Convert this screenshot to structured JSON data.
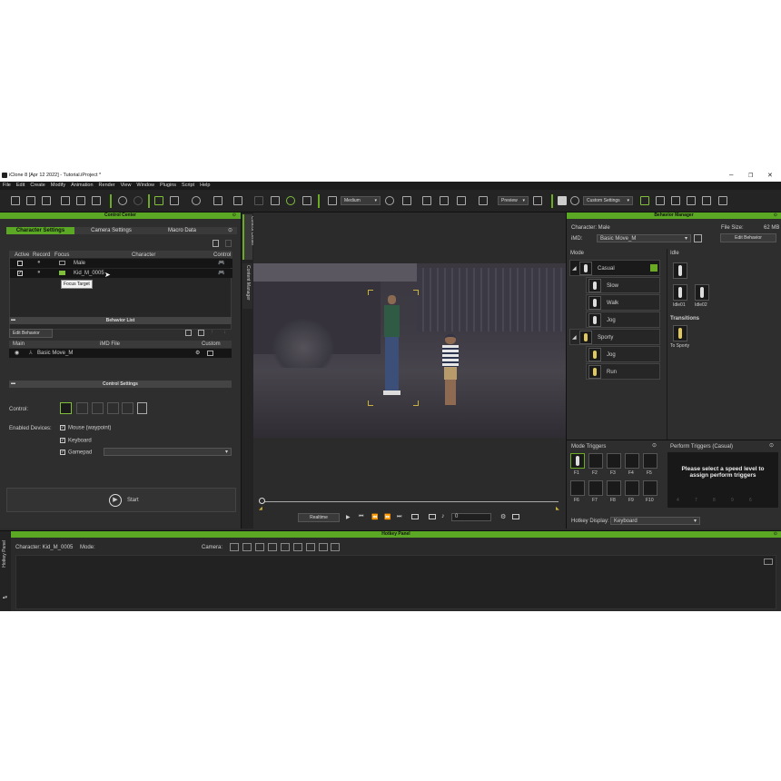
{
  "app": {
    "title": "iClone 8 [Apr 12 2022] - Tutorial.iProject *"
  },
  "menu": [
    "File",
    "Edit",
    "Create",
    "Modify",
    "Animation",
    "Render",
    "View",
    "Window",
    "Plugins",
    "Script",
    "Help"
  ],
  "toolbar": {
    "quality": "Medium",
    "preview": "Preview",
    "custom": "Custom Settings"
  },
  "control_center": {
    "title": "Control Center",
    "tabs": [
      "Character Settings",
      "Camera Settings",
      "Macro Data"
    ],
    "table_headers": [
      "Active",
      "Record",
      "Focus",
      "Character",
      "Control"
    ],
    "rows": [
      "Male",
      "Kid_M_0005"
    ],
    "tooltip": "Focus Target",
    "behavior_list": {
      "title": "Behavior List",
      "edit": "Edit Behavior",
      "headers": [
        "Main",
        "iMD File",
        "Custom"
      ],
      "row": "Basic Move_M"
    },
    "control_settings": {
      "title": "Control Settings",
      "control_label": "Control:",
      "enabled_label": "Enabled Devices:",
      "devices": [
        "Mouse (waypoint)",
        "Keyboard",
        "Gamepad"
      ]
    },
    "start": "Start"
  },
  "side_tabs": {
    "control_center": "Control Center",
    "content_manager": "Content Manager",
    "hotkey": "Hotkey Panel"
  },
  "playback": {
    "realtime": "Realtime",
    "frame": "0"
  },
  "behavior_manager": {
    "title": "Behavior Manager",
    "character": "Character: Male",
    "file_size_label": "File Size:",
    "file_size": "62 MB",
    "imd_label": "iMD:",
    "imd": "Basic Move_M",
    "edit": "Edit Behavior",
    "mode_label": "Mode",
    "idle_label": "Idle",
    "modes": [
      {
        "name": "Casual",
        "level": 0
      },
      {
        "name": "Slow",
        "level": 1
      },
      {
        "name": "Walk",
        "level": 1
      },
      {
        "name": "Jog",
        "level": 1
      },
      {
        "name": "Sporty",
        "level": 0
      },
      {
        "name": "Jog",
        "level": 1
      },
      {
        "name": "Run",
        "level": 1
      }
    ],
    "idles": [
      "Idle01",
      "Idle02"
    ],
    "transitions_label": "Transitions",
    "transition": "To Sporty",
    "mode_triggers": "Mode Triggers",
    "perform_triggers": "Perform Triggers (Casual)",
    "fkeys": [
      "F1",
      "F2",
      "F3",
      "F4",
      "F5",
      "F6",
      "F7",
      "F8",
      "F9",
      "F10"
    ],
    "perform_msg": "Please select a speed level to assign perform triggers",
    "perform_nums": [
      "4",
      "7",
      "8",
      "9",
      "6"
    ],
    "hotkey_label": "Hotkey Display:",
    "hotkey": "Keyboard"
  },
  "hotkey_panel": {
    "title": "Hotkey Panel",
    "character": "Character: Kid_M_0005",
    "mode": "Mode:",
    "camera": "Camera:"
  }
}
